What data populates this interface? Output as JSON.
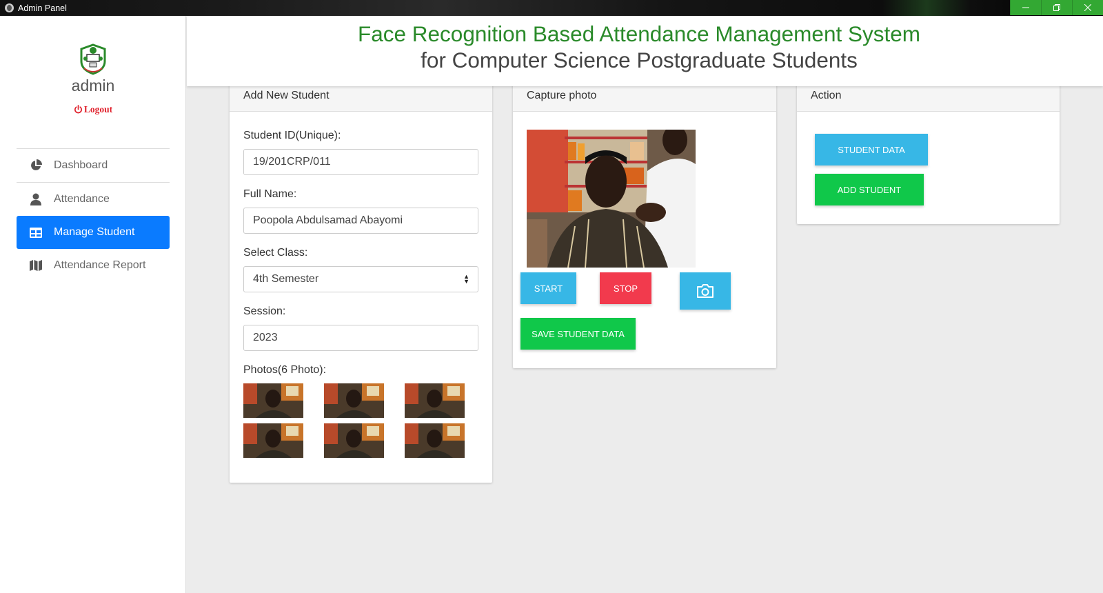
{
  "window": {
    "title": "Admin Panel",
    "controls": [
      "minimize-icon",
      "restore-icon",
      "close-icon"
    ]
  },
  "header": {
    "line1": "Face Recognition Based Attendance Management System",
    "line2": "for Computer Science Postgraduate Students"
  },
  "sidebar": {
    "username": "admin",
    "logout_label": "Logout",
    "items": [
      {
        "label": "Dashboard",
        "icon": "pie-chart-icon",
        "active": false
      },
      {
        "label": "Attendance",
        "icon": "user-icon",
        "active": false
      },
      {
        "label": "Manage Student",
        "icon": "table-icon",
        "active": true
      },
      {
        "label": "Attendance Report",
        "icon": "map-icon",
        "active": false
      }
    ]
  },
  "add_student": {
    "title": "Add New Student",
    "student_id_label": "Student ID(Unique):",
    "student_id_value": "19/201CRP/011",
    "full_name_label": "Full Name:",
    "full_name_value": "Poopola Abdulsamad Abayomi",
    "class_label": "Select Class:",
    "class_value": "4th Semester",
    "session_label": "Session:",
    "session_value": "2023",
    "photos_label": "Photos(6 Photo):"
  },
  "capture": {
    "title": "Capture photo",
    "start_label": "START",
    "stop_label": "STOP",
    "camera_icon": "camera-icon",
    "save_label": "SAVE STUDENT DATA"
  },
  "action": {
    "title": "Action",
    "student_data_label": "STUDENT DATA",
    "add_student_label": "ADD STUDENT"
  },
  "colors": {
    "accent": "#0a7bff",
    "title_green": "#2a8a2a",
    "info": "#37b7e6",
    "danger": "#f23a4d",
    "success": "#10c84a",
    "logout": "#e0202b"
  }
}
